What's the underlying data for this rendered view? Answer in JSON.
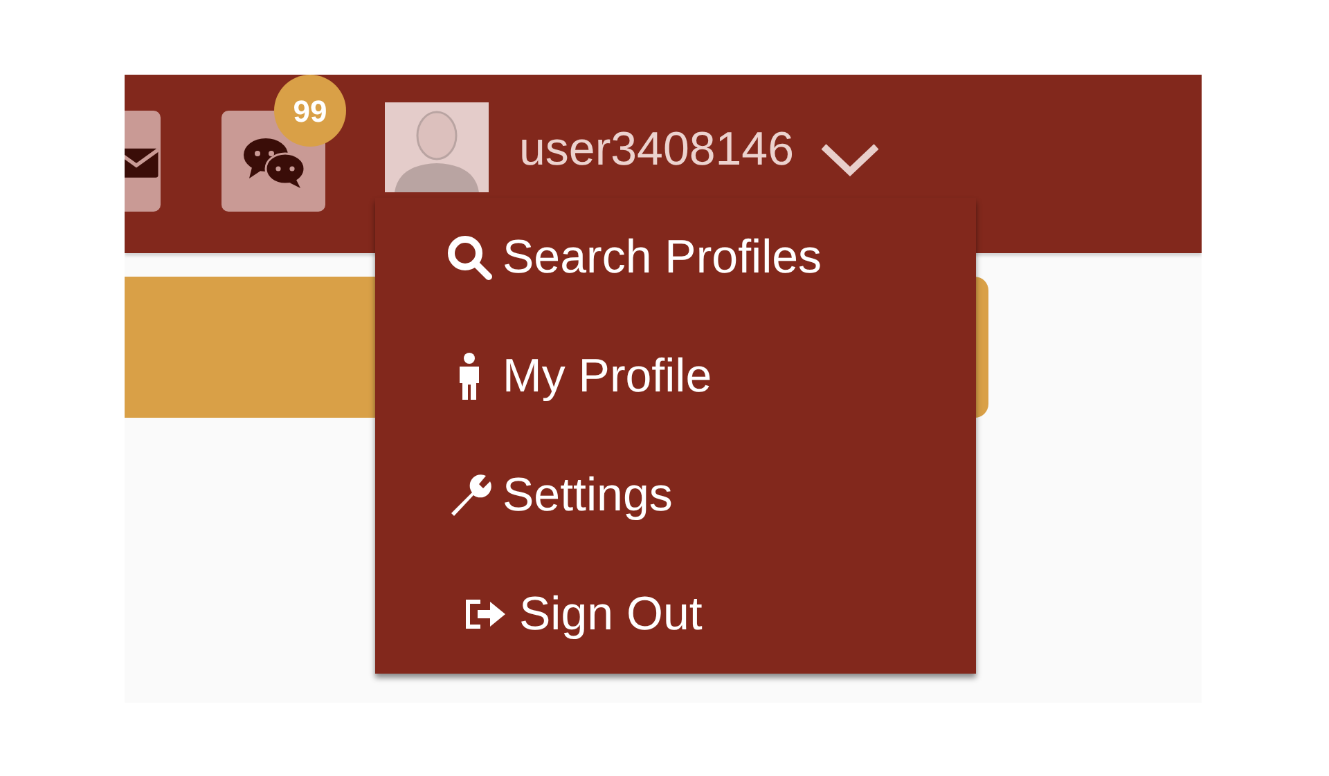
{
  "header": {
    "notification_badge": "99",
    "username": "user3408146"
  },
  "menu": {
    "items": [
      {
        "kind": "search",
        "label": "Search Profiles"
      },
      {
        "kind": "person",
        "label": "My Profile"
      },
      {
        "kind": "wrench",
        "label": "Settings"
      },
      {
        "kind": "signout",
        "label": "Sign Out"
      }
    ]
  }
}
